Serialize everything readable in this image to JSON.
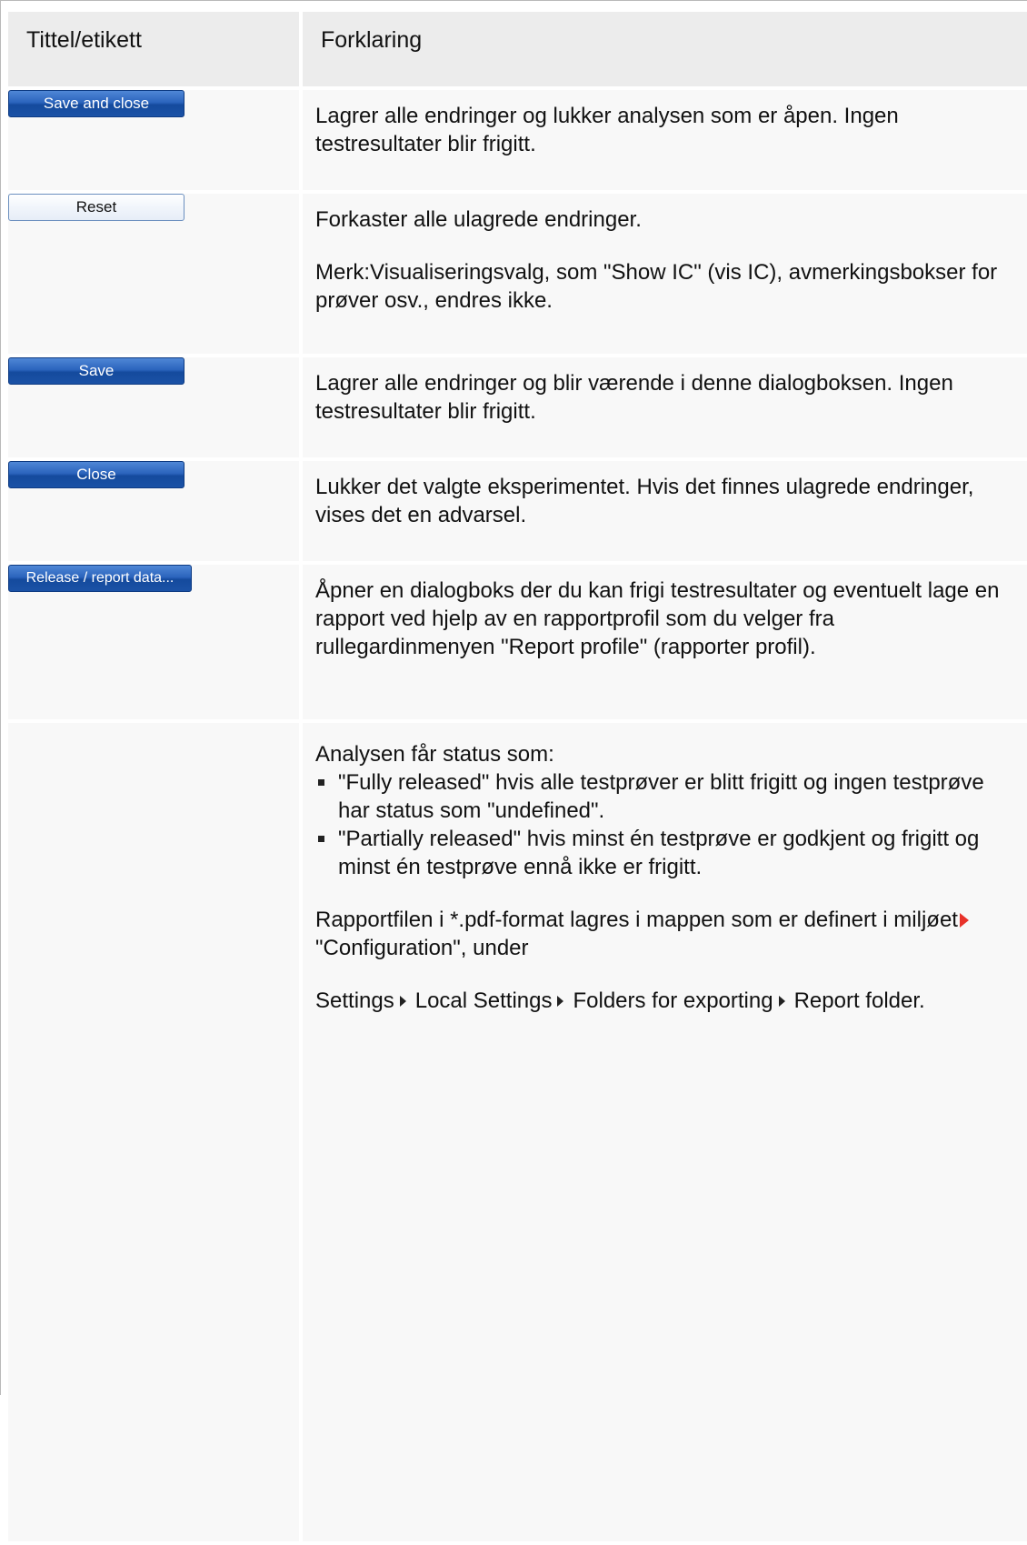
{
  "header": {
    "col1": "Tittel/etikett",
    "col2": "Forklaring"
  },
  "rows": [
    {
      "button": "Save and close",
      "text": "Lagrer alle endringer og lukker analysen som er åpen. Ingen testresultater blir frigitt."
    },
    {
      "button": "Reset",
      "text": "Forkaster alle ulagrede endringer.",
      "note": "Merk:Visualiseringsvalg, som \"Show IC\" (vis IC), avmerkingsbokser for prøver osv., endres ikke."
    },
    {
      "button": "Save",
      "text": "Lagrer alle endringer og blir værende i denne dialogboksen. Ingen testresultater blir frigitt."
    },
    {
      "button": "Close",
      "text": "Lukker det valgte eksperimentet. Hvis det finnes ulagrede endringer, vises det en advarsel."
    },
    {
      "button": "Release / report data...",
      "text": "Åpner en dialogboks der du kan frigi testresultater og eventuelt lage en rapport ved hjelp av en rapportprofil som du velger fra rullegardinmenyen \"Report profile\" (rapporter profil)."
    }
  ],
  "status_block": {
    "intro": "Analysen får status som:",
    "bullets": [
      "\"Fully released\" hvis alle testprøver er blitt frigitt og ingen testprøve har status som \"undefined\".",
      "\"Partially released\" hvis minst én testprøve er godkjent og frigitt og minst én testprøve ennå ikke er frigitt."
    ],
    "report_text_before": "Rapportfilen i *.pdf-format lagres i mappen som er definert i miljøet",
    "report_link": "\"Configuration\"",
    "report_text_after": ", under",
    "path": [
      "Settings",
      "Local Settings",
      "Folders for exporting",
      "Report folder."
    ]
  },
  "colors": {
    "button_blue": "#2b64bd",
    "header_bg": "#ececec",
    "cell_bg": "#f8f8f8",
    "link_arrow": "#e8322a"
  }
}
